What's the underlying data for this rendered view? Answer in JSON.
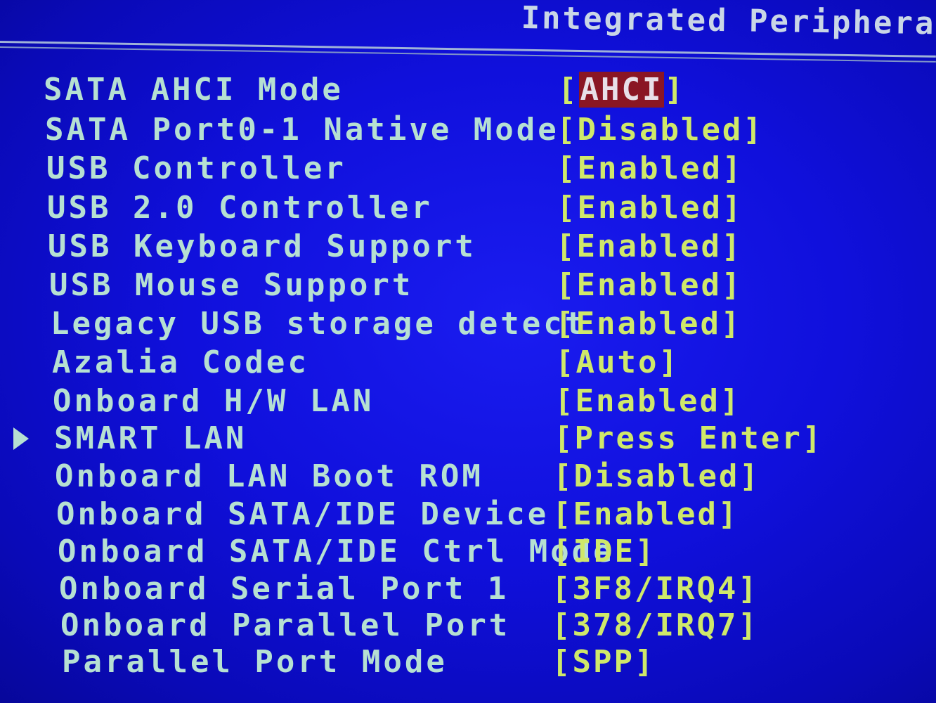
{
  "header": {
    "title": "Integrated Peripherals"
  },
  "items": [
    {
      "label": "SATA AHCI Mode",
      "value_open": "[",
      "value": "AHCI",
      "value_close": "]",
      "selected": true
    },
    {
      "label": "SATA Port0-1 Native Mode",
      "value_open": "[",
      "value": "Disabled",
      "value_close": "]"
    },
    {
      "label": "USB Controller",
      "value_open": "[",
      "value": "Enabled",
      "value_close": "]"
    },
    {
      "label": "USB 2.0 Controller",
      "value_open": "[",
      "value": "Enabled",
      "value_close": "]"
    },
    {
      "label": "USB Keyboard Support",
      "value_open": "[",
      "value": "Enabled",
      "value_close": "]"
    },
    {
      "label": "USB Mouse Support",
      "value_open": "[",
      "value": "Enabled",
      "value_close": "]"
    },
    {
      "label": "Legacy USB storage detect",
      "value_open": "[",
      "value": "Enabled",
      "value_close": "]"
    },
    {
      "label": "Azalia Codec",
      "value_open": "[",
      "value": "Auto",
      "value_close": "]"
    },
    {
      "label": "Onboard H/W LAN",
      "value_open": "[",
      "value": "Enabled",
      "value_close": "]"
    },
    {
      "label": "SMART LAN",
      "value_open": "[",
      "value": "Press Enter",
      "value_close": "]",
      "submenu": true
    },
    {
      "label": "Onboard LAN Boot ROM",
      "value_open": "[",
      "value": "Disabled",
      "value_close": "]"
    },
    {
      "label": "Onboard SATA/IDE Device",
      "value_open": "[",
      "value": "Enabled",
      "value_close": "]"
    },
    {
      "label": "Onboard SATA/IDE Ctrl Mode",
      "value_open": "[",
      "value": "IDE",
      "value_close": "]"
    },
    {
      "label": "Onboard Serial Port 1",
      "value_open": "[",
      "value": "3F8/IRQ4",
      "value_close": "]"
    },
    {
      "label": "Onboard Parallel Port",
      "value_open": "[",
      "value": "378/IRQ7",
      "value_close": "]"
    },
    {
      "label": "Parallel Port Mode",
      "value_open": "[",
      "value": "SPP",
      "value_close": "]"
    }
  ],
  "colors": {
    "background": "#1010dc",
    "label_text": "#b6e0d2",
    "value_text": "#cfe86a",
    "highlight_bg": "#8a1624"
  },
  "icons": {
    "submenu_pointer": "triangle-right-icon"
  }
}
